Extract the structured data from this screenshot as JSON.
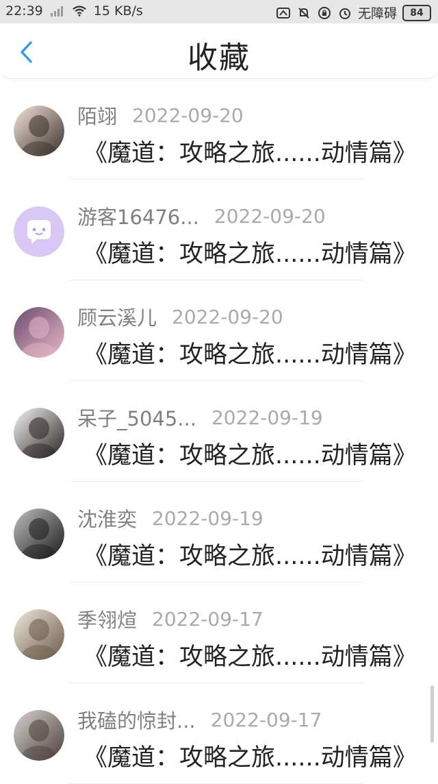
{
  "status_bar": {
    "time": "22:39",
    "net_speed": "15 KB/s",
    "accessibility": "无障碍",
    "battery": "84"
  },
  "header": {
    "title": "收藏"
  },
  "favorites": [
    {
      "user": "陌翊",
      "date": "2022-09-20",
      "title": "《魔道：攻略之旅......动情篇》",
      "avatar_colors": [
        "#f3e6dc",
        "#3a2f2a"
      ]
    },
    {
      "user": "游客16476...",
      "date": "2022-09-20",
      "title": "《魔道：攻略之旅......动情篇》",
      "avatar_colors": [
        "#d9c8f5",
        "#ffffff"
      ]
    },
    {
      "user": "顾云溪儿",
      "date": "2022-09-20",
      "title": "《魔道：攻略之旅......动情篇》",
      "avatar_colors": [
        "#6a4b6e",
        "#e7b8c8"
      ]
    },
    {
      "user": "呆子_5045...",
      "date": "2022-09-19",
      "title": "《魔道：攻略之旅......动情篇》",
      "avatar_colors": [
        "#f5f5f5",
        "#2a2222"
      ]
    },
    {
      "user": "沈淮奕",
      "date": "2022-09-19",
      "title": "《魔道：攻略之旅......动情篇》",
      "avatar_colors": [
        "#bfbfbf",
        "#1a1a1a"
      ]
    },
    {
      "user": "季翎煊",
      "date": "2022-09-17",
      "title": "《魔道：攻略之旅......动情篇》",
      "avatar_colors": [
        "#efe7dc",
        "#6b5a4a"
      ]
    },
    {
      "user": "我磕的惊封...",
      "date": "2022-09-17",
      "title": "《魔道：攻略之旅......动情篇》",
      "avatar_colors": [
        "#d8d2cf",
        "#4a403c"
      ]
    }
  ]
}
